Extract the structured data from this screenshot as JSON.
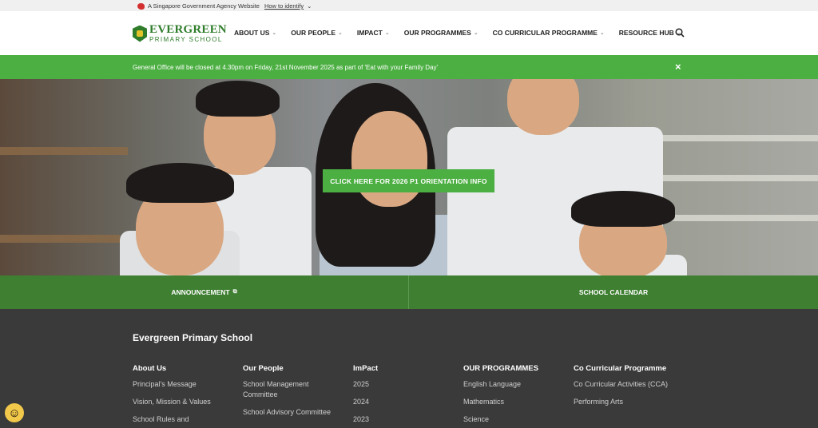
{
  "gov_bar": {
    "text": "A Singapore Government Agency Website",
    "identify": "How to identify"
  },
  "logo": {
    "name": "EVERGREEN",
    "sub": "PRIMARY SCHOOL"
  },
  "nav": [
    {
      "label": "ABOUT US"
    },
    {
      "label": "OUR PEOPLE"
    },
    {
      "label": "IMPACT"
    },
    {
      "label": "OUR PROGRAMMES"
    },
    {
      "label": "CO CURRICULAR PROGRAMME"
    },
    {
      "label": "RESOURCE HUB"
    }
  ],
  "alert": {
    "message": "General Office will be closed at 4.30pm on Friday, 21st November 2025 as part of 'Eat with your Family Day'",
    "close": "×"
  },
  "hero": {
    "cta": "CLICK HERE FOR 2026 P1 ORIENTATION INFO"
  },
  "quick_links": {
    "announcement": "ANNOUNCEMENT",
    "calendar": "SCHOOL CALENDAR"
  },
  "footer": {
    "school_name": "Evergreen Primary School",
    "columns": [
      {
        "head": "About Us",
        "links": [
          "Principal's Message",
          "Vision, Mission & Values",
          "School Rules and"
        ]
      },
      {
        "head": "Our People",
        "links": [
          "School Management Committee",
          "School Advisory Committee"
        ]
      },
      {
        "head": "ImPact",
        "links": [
          "2025",
          "2024",
          "2023"
        ]
      },
      {
        "head": "OUR PROGRAMMES",
        "links": [
          "English Language",
          "Mathematics",
          "Science"
        ]
      },
      {
        "head": "Co Curricular Programme",
        "links": [
          "Co Curricular Activities (CCA)",
          "Performing Arts"
        ]
      }
    ]
  },
  "colors": {
    "brand_green": "#2f7d2b",
    "alert_green": "#4caf42",
    "quick_green": "#3f7f32",
    "footer_bg": "#3a3a3a"
  }
}
